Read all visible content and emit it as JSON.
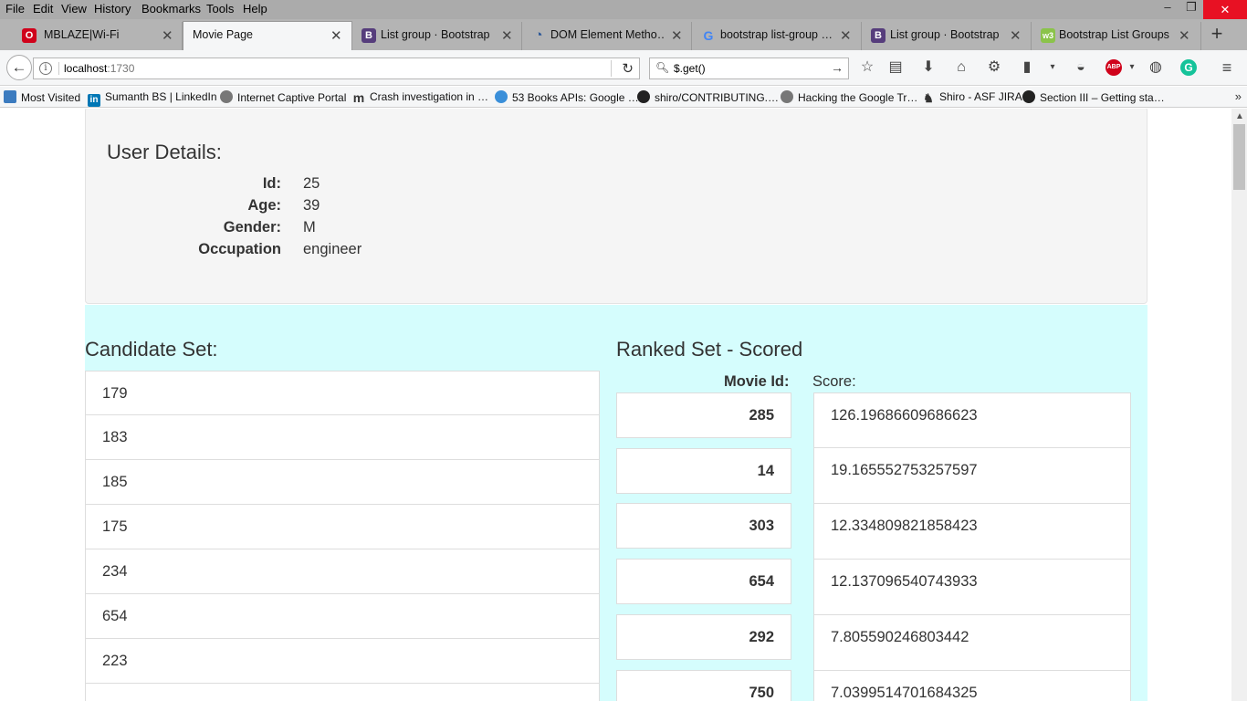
{
  "menu": [
    "File",
    "Edit",
    "View",
    "History",
    "Bookmarks",
    "Tools",
    "Help"
  ],
  "window_controls": {
    "minimize": "–",
    "restore": "❐",
    "close": "✕"
  },
  "tabs": [
    {
      "title": "MBLAZE|Wi-Fi",
      "icon": "opera-icon",
      "color": "#d0021b"
    },
    {
      "title": "Movie Page",
      "icon": "blank-page-icon",
      "color": "#ffffff"
    },
    {
      "title": "List group · Bootstrap",
      "icon": "bootstrap-icon",
      "color": "#563d7c"
    },
    {
      "title": "DOM Element Metho…",
      "icon": "w3-icon",
      "color": "#2b5797"
    },
    {
      "title": "bootstrap list-group …",
      "icon": "google-icon",
      "color": "#4285f4"
    },
    {
      "title": "List group · Bootstrap",
      "icon": "bootstrap-icon",
      "color": "#563d7c"
    },
    {
      "title": "Bootstrap List Groups",
      "icon": "w3schools-icon",
      "color": "#8bc34a"
    }
  ],
  "address_bar": {
    "host": "localhost",
    "port": ":1730"
  },
  "search_bar": {
    "query": "$.get()"
  },
  "bookmarks": [
    {
      "label": "Most Visited",
      "color": "#3b7bbf"
    },
    {
      "label": "Sumanth BS | LinkedIn",
      "color": "#0077b5"
    },
    {
      "label": "Internet Captive Portal",
      "color": "#777777"
    },
    {
      "label": "Crash investigation in …",
      "color": "#333333"
    },
    {
      "label": "53 Books APIs: Google …",
      "color": "#3a8fd9"
    },
    {
      "label": "shiro/CONTRIBUTING.…",
      "color": "#222222"
    },
    {
      "label": "Hacking the Google Tr…",
      "color": "#777777"
    },
    {
      "label": "Shiro - ASF JIRA",
      "color": "#333333"
    },
    {
      "label": "Section III – Getting sta…",
      "color": "#222222"
    }
  ],
  "user_details": {
    "title": "User Details:",
    "fields": [
      {
        "label": "Id:",
        "value": "25"
      },
      {
        "label": "Age:",
        "value": "39"
      },
      {
        "label": "Gender:",
        "value": "M"
      },
      {
        "label": "Occupation",
        "value": "engineer"
      }
    ]
  },
  "candidate_set": {
    "title": "Candidate Set:",
    "items": [
      "179",
      "183",
      "185",
      "175",
      "234",
      "654",
      "223"
    ]
  },
  "ranked_set": {
    "title": "Ranked Set - Scored",
    "movie_id_header": "Movie Id:",
    "score_header": "Score:",
    "rows": [
      {
        "movie_id": "285",
        "score": "126.19686609686623"
      },
      {
        "movie_id": "14",
        "score": "19.165552753257597"
      },
      {
        "movie_id": "303",
        "score": "12.334809821858423"
      },
      {
        "movie_id": "654",
        "score": "12.137096540743933"
      },
      {
        "movie_id": "292",
        "score": "7.805590246803442"
      },
      {
        "movie_id": "750",
        "score": "7.0399514701684325"
      }
    ]
  },
  "colors": {
    "lower_bg": "#d5fdfd",
    "panel_bg": "#f5f5f5"
  }
}
